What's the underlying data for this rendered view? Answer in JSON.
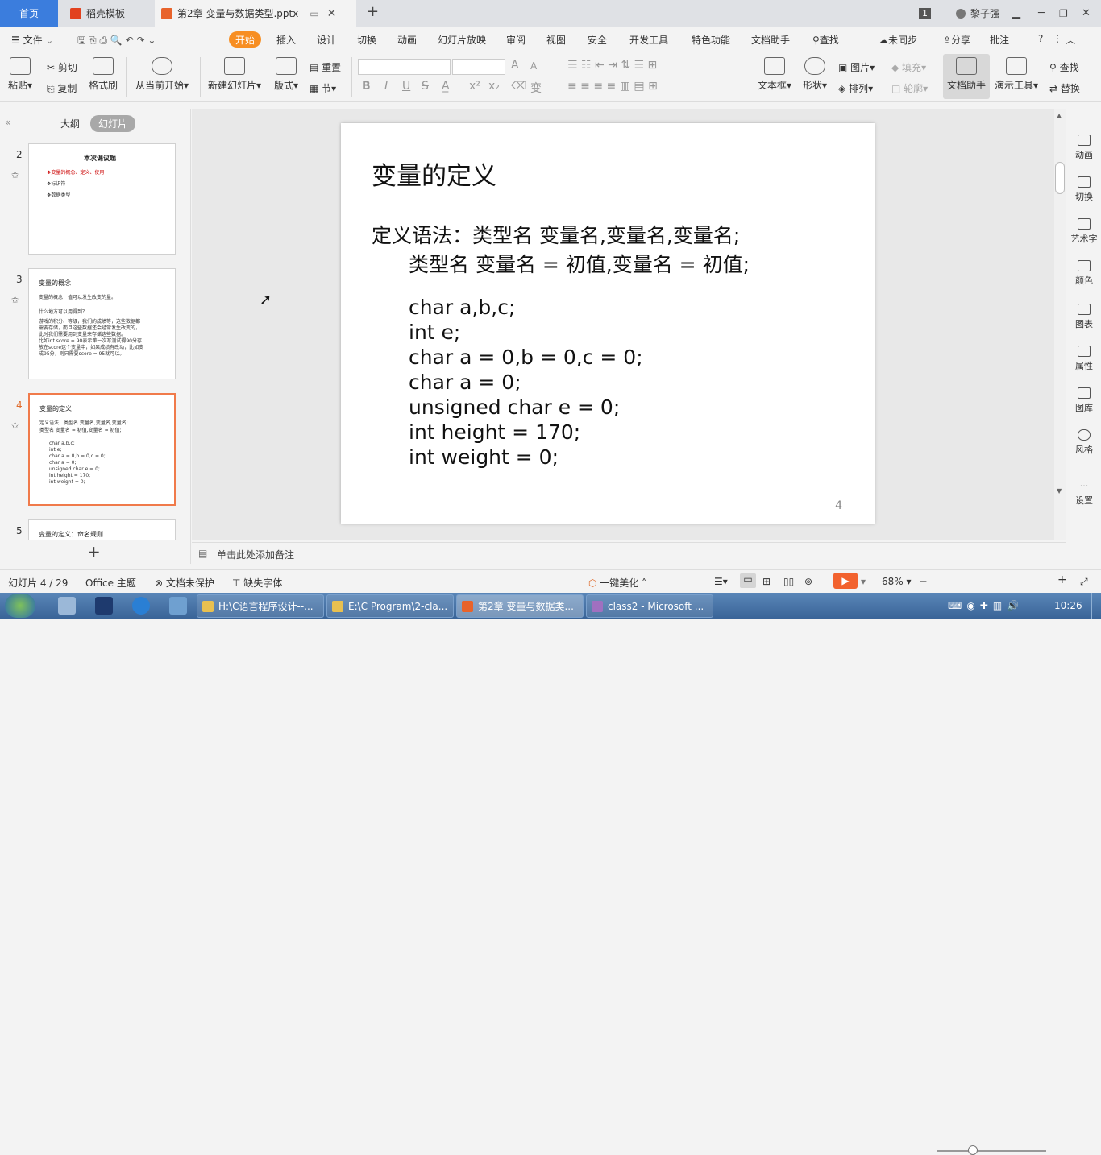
{
  "tabs": {
    "home": "首页",
    "template": "稻壳模板",
    "document": "第2章 变量与数据类型.pptx",
    "badge": "1",
    "user": "黎子强"
  },
  "menu": {
    "file": "文件",
    "items": [
      "开始",
      "插入",
      "设计",
      "切换",
      "动画",
      "幻灯片放映",
      "审阅",
      "视图",
      "安全",
      "开发工具",
      "特色功能",
      "文档助手"
    ],
    "search": "查找",
    "sync": "未同步",
    "share": "分享",
    "comment": "批注"
  },
  "ribbon": {
    "paste": "粘贴",
    "cut": "剪切",
    "copy": "复制",
    "format_painter": "格式刷",
    "from_current": "从当前开始",
    "new_slide": "新建幻灯片",
    "layout": "版式",
    "reset": "重置",
    "section": "节",
    "textbox": "文本框",
    "shape": "形状",
    "picture": "图片",
    "fill": "填充",
    "arrange": "排列",
    "outline": "轮廓",
    "doc_assistant": "文档助手",
    "presentation_tools": "演示工具",
    "find": "查找",
    "replace": "替换",
    "font_a_big": "A",
    "font_a_small": "A",
    "bold": "B",
    "italic": "I",
    "underline": "U",
    "strike": "S"
  },
  "left_pane": {
    "outline_tab": "大纲",
    "slides_tab": "幻灯片",
    "thumbs": [
      {
        "num": "2",
        "title": "本次课议题",
        "lines": [
          "❖变量的概念、定义、使用",
          "❖标识符",
          "❖数据类型"
        ]
      },
      {
        "num": "3",
        "title": "变量的概念",
        "lines": [
          "变量的概念：值可以发生改变的量。",
          "",
          "什么地方可以用得到？",
          "游戏的积分、等级，我们的成绩等，这些数据都",
          "需要存储，而且这些数据还会经常发生改变的，",
          "此时我们需要用到变量来存储这些数据。",
          "比如int score = 90表示第一次写测试得90分存",
          "放在score这个变量中，如果成绩有改动，比如变",
          "成95分，则只需要score = 95就可以。"
        ]
      },
      {
        "num": "4",
        "title": "变量的定义",
        "lines": [
          "定义语法：类型名 变量名,变量名,变量名;",
          "       类型名 变量名 = 初值,变量名 = 初值;",
          "",
          "char a,b,c;",
          "int e;",
          "char a = 0,b = 0,c = 0;",
          "char a = 0;",
          "unsigned char e = 0;",
          "int height = 170;",
          "int weight = 0;"
        ]
      },
      {
        "num": "5",
        "title": "变量的定义：命名规则"
      }
    ],
    "add": "+"
  },
  "slide": {
    "title": "变量的定义",
    "syntax1": "定义语法：类型名 变量名,变量名,变量名;",
    "syntax2": "类型名 变量名 = 初值,变量名 = 初值;",
    "code": [
      "char a,b,c;",
      "int e;",
      "char a = 0,b = 0,c = 0;",
      "char a = 0;",
      "unsigned char e = 0;",
      "int height = 170;",
      "int weight = 0;"
    ],
    "page_number": "4"
  },
  "right_rail": [
    "动画",
    "切换",
    "艺术字",
    "颜色",
    "图表",
    "属性",
    "图库",
    "风格",
    "设置"
  ],
  "notes_placeholder": "单击此处添加备注",
  "status": {
    "slide_counter": "幻灯片 4 / 29",
    "theme": "Office 主题",
    "protect": "文档未保护",
    "missing_font": "缺失字体",
    "beautify": "一键美化",
    "zoom": "68%"
  },
  "taskbar": {
    "items": [
      "H:\\C语言程序设计--...",
      "E:\\C Program\\2-cla...",
      "第2章 变量与数据类...",
      "class2 - Microsoft ..."
    ],
    "clock": "10:26"
  },
  "colors": {
    "accent": "#f78e22",
    "home_tab": "#3b7ddd",
    "selected_thumb": "#f07a4a"
  }
}
